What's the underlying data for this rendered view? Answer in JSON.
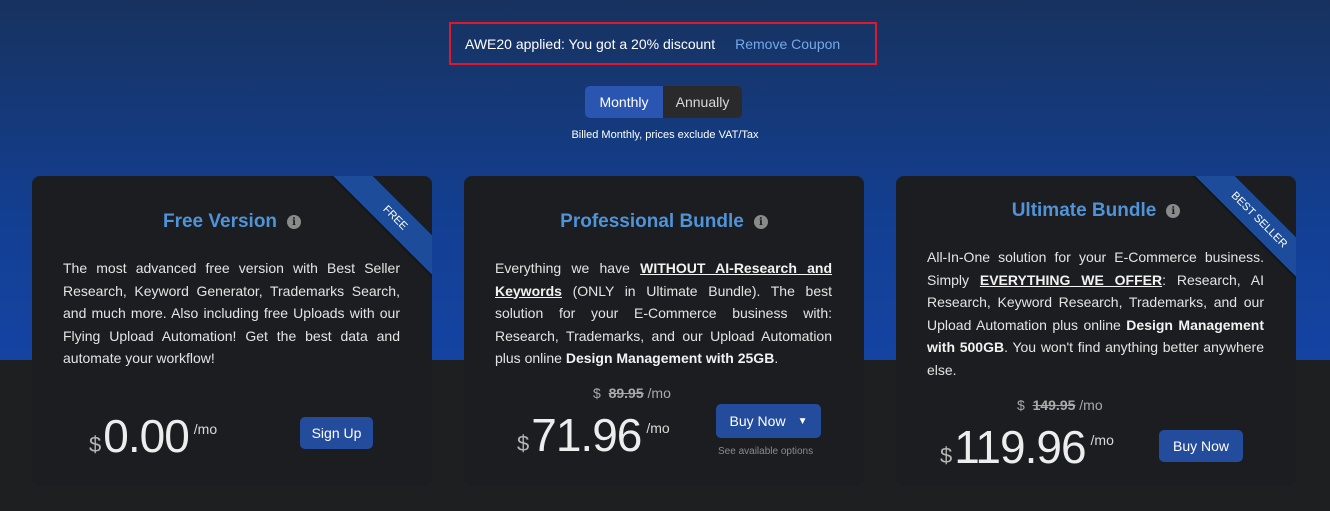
{
  "coupon": {
    "message": "AWE20 applied: You got a 20% discount",
    "remove_label": "Remove Coupon"
  },
  "billing_toggle": {
    "monthly": "Monthly",
    "annually": "Annually",
    "selected": "Monthly"
  },
  "billing_note": "Billed Monthly, prices exclude VAT/Tax",
  "colors": {
    "accent": "#4f93d8",
    "button": "#244c9c",
    "coupon_border": "#e0182b"
  },
  "plans": [
    {
      "title": "Free Version",
      "ribbon": "FREE",
      "desc": "The most advanced free version with Best Seller Research, Keyword Generator, Trademarks Search, and much more. Also including free Uploads with our Flying Upload Automation! Get the best data and automate your workflow!",
      "currency": "$",
      "price": "0.00",
      "period": "/mo",
      "button": "Sign Up"
    },
    {
      "title": "Professional Bundle",
      "desc_1": "Everything we have ",
      "desc_u": "WITHOUT AI-Research and Keywords",
      "desc_2": " (ONLY in Ultimate Bundle). The best solution for your E-Commerce business with: Research, Trademarks, and our Upload Automation plus online ",
      "desc_b": "Design Management with 25GB",
      "desc_3": ".",
      "old_currency": "$",
      "old_price": "89.95",
      "old_period": "/mo",
      "currency": "$",
      "price": "71.96",
      "period": "/mo",
      "button": "Buy Now",
      "options_link": "See available options"
    },
    {
      "title": "Ultimate Bundle",
      "ribbon": "BEST SELLER",
      "desc_1": "All-In-One solution for your E-Commerce business. Simply ",
      "desc_u": "EVERYTHING WE OFFER",
      "desc_2": ": Research, AI Research, Keyword Research, Trademarks, and our Upload Automation plus online ",
      "desc_b": "Design Management with 500GB",
      "desc_3": ". You won't find anything better anywhere else.",
      "old_currency": "$",
      "old_price": "149.95",
      "old_period": "/mo",
      "currency": "$",
      "price": "119.96",
      "period": "/mo",
      "button": "Buy Now"
    }
  ]
}
